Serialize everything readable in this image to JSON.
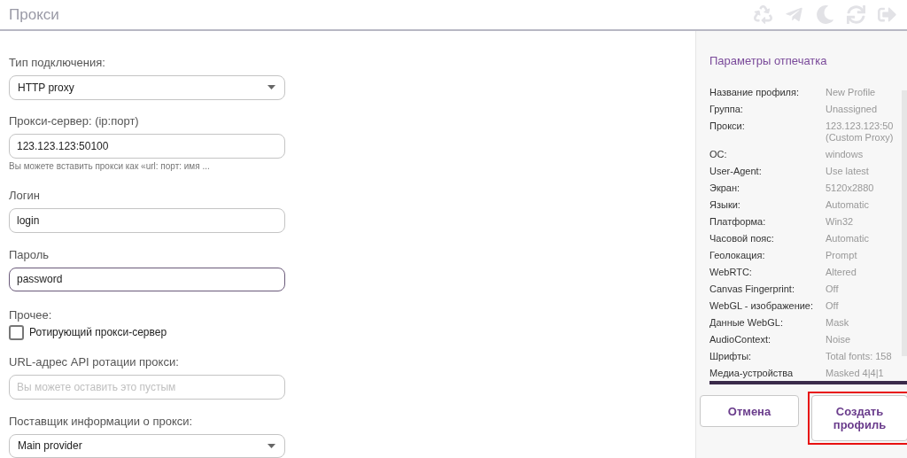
{
  "header": {
    "title": "Прокси"
  },
  "form": {
    "connection_type": {
      "label": "Тип подключения:",
      "value": "HTTP proxy"
    },
    "proxy_server": {
      "label": "Прокси-сервер: (ip:порт)",
      "value": "123.123.123:50100",
      "hint": "Вы можете вставить прокси как «url: порт: имя ..."
    },
    "login": {
      "label": "Логин",
      "value": "login"
    },
    "password": {
      "label": "Пароль",
      "value": "password",
      "focused": true
    },
    "other": {
      "label": "Прочее:",
      "checkbox": {
        "label": "Ротирующий прокси-сервер",
        "checked": false
      }
    },
    "rotation_url": {
      "label": "URL-адрес API ротации прокси:",
      "placeholder": "Вы можете оставить это пустым"
    },
    "info_provider": {
      "label": "Поставщик информации о прокси:",
      "value": "Main provider"
    }
  },
  "summary": {
    "title": "Параметры отпечатка",
    "rows": [
      {
        "label": "Название профиля:",
        "value": "New Profile"
      },
      {
        "label": "Группа:",
        "value": "Unassigned"
      },
      {
        "label": "Прокси:",
        "value": "123.123.123:50",
        "value_2": "(Custom Proxy)"
      },
      {
        "label": "ОС:",
        "value": "windows"
      },
      {
        "label": "User-Agent:",
        "value": "Use latest"
      },
      {
        "label": "Экран:",
        "value": "5120x2880"
      },
      {
        "label": "Языки:",
        "value": "Automatic"
      },
      {
        "label": "Платформа:",
        "value": "Win32"
      },
      {
        "label": "Часовой пояс:",
        "value": "Automatic"
      },
      {
        "label": "Геолокация:",
        "value": "Prompt"
      },
      {
        "label": "WebRTC:",
        "value": "Altered"
      },
      {
        "label": "Canvas Fingerprint:",
        "value": "Off"
      },
      {
        "label": "WebGL - изображение:",
        "value": "Off"
      },
      {
        "label": "Данные WebGL:",
        "value": "Mask"
      },
      {
        "label": "AudioContext:",
        "value": "Noise"
      },
      {
        "label": "Шрифты:",
        "value": "Total fonts: 158"
      },
      {
        "label": "Медиа-устройства",
        "value": "Masked 4|4|1"
      }
    ]
  },
  "buttons": [
    {
      "label": "Отмена",
      "highlighted": false
    },
    {
      "label": "Создать профиль",
      "highlighted": true
    }
  ]
}
